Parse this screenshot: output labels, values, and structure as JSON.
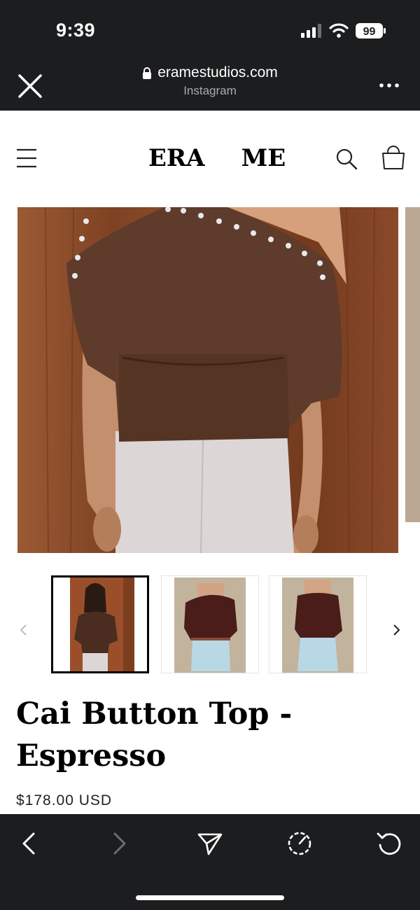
{
  "status": {
    "time": "9:39",
    "battery": "99"
  },
  "browser": {
    "domain": "eramestudios.com",
    "source": "Instagram"
  },
  "site": {
    "logo_left": "ERA",
    "logo_right": "ME"
  },
  "product": {
    "title": "Cai Button Top - Espresso",
    "price": "$178.00 USD",
    "thumbnails": [
      "thumb-1",
      "thumb-2",
      "thumb-3"
    ],
    "active_thumbnail": 0
  },
  "colors": {
    "browser_chrome": "#1c1d1f",
    "espresso": "#5a3a2a",
    "wood": "#8a4a2a"
  },
  "icons": {
    "close": "close-icon",
    "lock": "lock-icon",
    "more": "more-icon",
    "menu": "hamburger-icon",
    "search": "search-icon",
    "cart": "cart-icon",
    "prev": "chevron-left-icon",
    "next": "chevron-right-icon",
    "back": "back-icon",
    "forward": "forward-icon",
    "share": "share-icon",
    "speed": "speed-icon",
    "reload": "reload-icon"
  }
}
